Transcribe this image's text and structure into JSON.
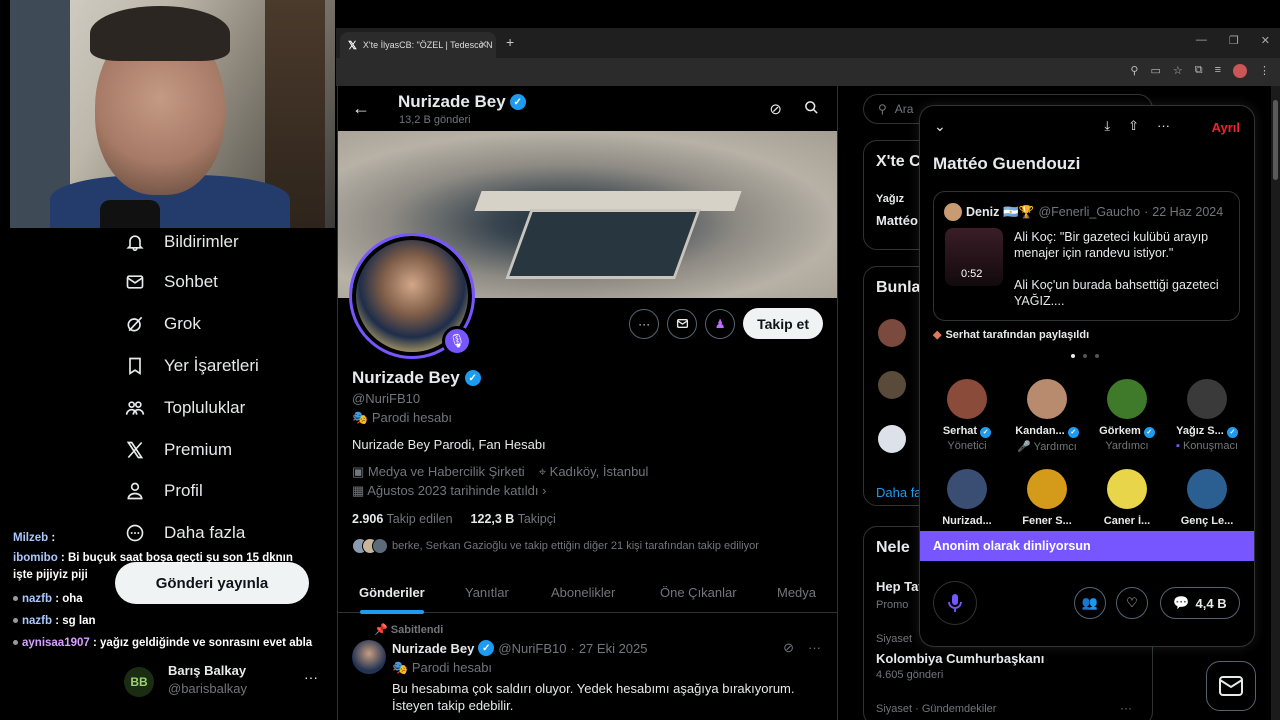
{
  "browser": {
    "tab_title": "X'te İlyasCB: \"ÖZEL | Tedesco N",
    "tab_icon": "x-logo-icon"
  },
  "sidebar": {
    "items": [
      {
        "label": "Bildirimler",
        "icon": "bell-icon"
      },
      {
        "label": "Sohbet",
        "icon": "mail-icon"
      },
      {
        "label": "Grok",
        "icon": "grok-icon"
      },
      {
        "label": "Yer İşaretleri",
        "icon": "bookmark-icon"
      },
      {
        "label": "Topluluklar",
        "icon": "communities-icon"
      },
      {
        "label": "Premium",
        "icon": "x-logo-icon"
      },
      {
        "label": "Profil",
        "icon": "person-icon"
      },
      {
        "label": "Daha fazla",
        "icon": "more-circle-icon"
      }
    ],
    "post_button": "Gönderi yayınla",
    "account": {
      "name": "Barış Balkay",
      "handle": "@barisbalkay",
      "avatar_text": "BB"
    }
  },
  "chat": [
    {
      "user": "Milzeb",
      "text": ":",
      "user_color": "#a9c7ff"
    },
    {
      "user": "ibomibo",
      "text": ": Bi buçuk saat boşa geçti şu son 15 dknın işte pijiyiz piji",
      "user_color": "#a9c7ff"
    },
    {
      "user": "nazfb",
      "text": ": oha",
      "user_color": "#a9c7ff"
    },
    {
      "user": "nazfb",
      "text": ": sg lan",
      "user_color": "#a9c7ff"
    },
    {
      "user": "aynisaa1907",
      "text": ": yağız geldiğinde ve sonrasını evet abla",
      "user_color": "#d7a2ff"
    }
  ],
  "profile": {
    "top_name": "Nurizade Bey",
    "post_count": "13,2 B gönderi",
    "name": "Nurizade Bey",
    "handle": "@NuriFB10",
    "parody_label": "Parodi hesabı",
    "bio": "Nurizade Bey Parodi, Fan Hesabı",
    "category": "Medya ve Habercilik Şirketi",
    "location": "Kadıköy, İstanbul",
    "joined": "Ağustos 2023 tarihinde katıldı",
    "following_count": "2.906",
    "following_label": "Takip edilen",
    "followers_count": "122,3 B",
    "followers_label": "Takipçi",
    "followed_by": "berke, Serkan Gazioğlu ve takip ettiğin diğer 21 kişi tarafından takip ediliyor",
    "follow_button": "Takip et",
    "tabs": [
      "Gönderiler",
      "Yanıtlar",
      "Abonelikler",
      "Öne Çıkanlar",
      "Medya"
    ],
    "active_tab": 0
  },
  "pinned_tweet": {
    "pinned_label": "Sabitlendi",
    "name": "Nurizade Bey",
    "handle": "@NuriFB10",
    "date": "27 Eki 2025",
    "parody_label": "Parodi hesabı",
    "text": "Bu hesabıma çok saldırı oluyor. Yedek hesabımı aşağıya bırakıyorum. İsteyen takip edebilir."
  },
  "right": {
    "search_placeholder": "Ara",
    "card1_title": "X'te C",
    "card1_line1": "Yağız",
    "card1_line2": "Mattéo",
    "card2_title": "Bunla",
    "card2_link": "Daha fa",
    "card3_title": "Nele",
    "trend1": "Hep Tat",
    "trend1_sub": "Promo",
    "trend2_cat": "Siyaset",
    "trend2": "Kolombiya Cumhurbaşkanı",
    "trend2_count": "4.605 gönderi",
    "trend3_cat": "Siyaset · Gündemdekiler"
  },
  "space": {
    "leave": "Ayrıl",
    "title": "Mattéo Guendouzi",
    "tweet": {
      "name": "Deniz",
      "handle": "@Fenerli_Gaucho",
      "date": "22 Haz 2024",
      "video_time": "0:52",
      "line1": "Ali Koç: \"Bir gazeteci kulübü arayıp menajer için randevu istiyor.\"",
      "line2": "Ali Koç'un burada bahsettiği gazeteci YAĞIZ...."
    },
    "shared_by": "Serhat tarafından paylaşıldı",
    "people": [
      {
        "name": "Serhat",
        "role": "Yönetici",
        "color": "#8a4b3a"
      },
      {
        "name": "Kandan...",
        "role": "Yardımcı",
        "color": "#b88a6e"
      },
      {
        "name": "Görkem",
        "role": "Yardımcı",
        "color": "#3f7a2a"
      },
      {
        "name": "Yağız S...",
        "role": "Konuşmacı",
        "color": "#3a3a3a"
      },
      {
        "name": "Nurizad...",
        "role": "",
        "color": "#3a4d72"
      },
      {
        "name": "Fener S...",
        "role": "",
        "color": "#d49a1a"
      },
      {
        "name": "Caner İ...",
        "role": "",
        "color": "#e8d54a"
      },
      {
        "name": "Genç Le...",
        "role": "",
        "color": "#2b5f91"
      }
    ],
    "listening_banner": "Anonim olarak dinliyorsun",
    "listener_count": "4,4 B"
  }
}
